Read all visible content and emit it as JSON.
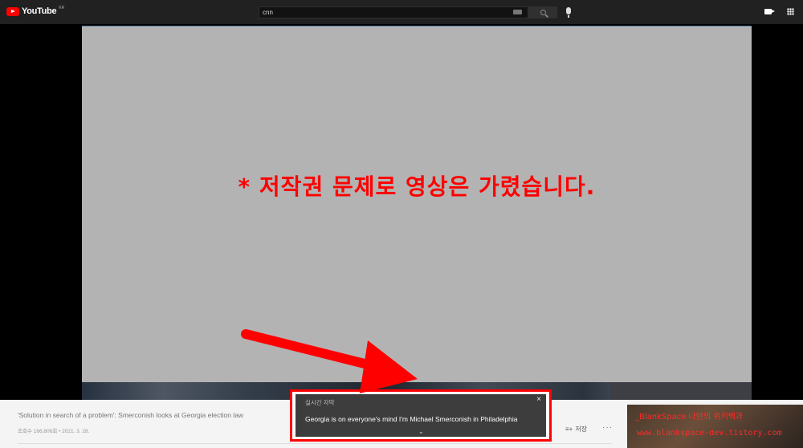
{
  "header": {
    "logo_text": "YouTube",
    "logo_region": "KR",
    "search_value": "cnn"
  },
  "video": {
    "notice": "* 저작권 문제로 영상은 가렸습니다."
  },
  "info": {
    "title": "'Solution in search of a problem': Smerconish looks at Georgia election law",
    "meta": "조회수 166,806회 • 2021. 3. 28.",
    "save_label": "저장",
    "more_label": "···",
    "like_count": "",
    "dislike_count": ""
  },
  "caption": {
    "header": "실시간 자막",
    "text": "Georgia is on everyone's mind I'm Michael Smerconish in Philadelphia",
    "close_label": "×",
    "expand_label": "⌄"
  },
  "watermark": {
    "line1": "_BlankSpace 나만의 위키백과",
    "line2": "www.blankspace-dev.tistory.com"
  },
  "colors": {
    "highlight": "#ff0000",
    "video_placeholder": "#b3b3b3",
    "topbar": "#212121"
  }
}
